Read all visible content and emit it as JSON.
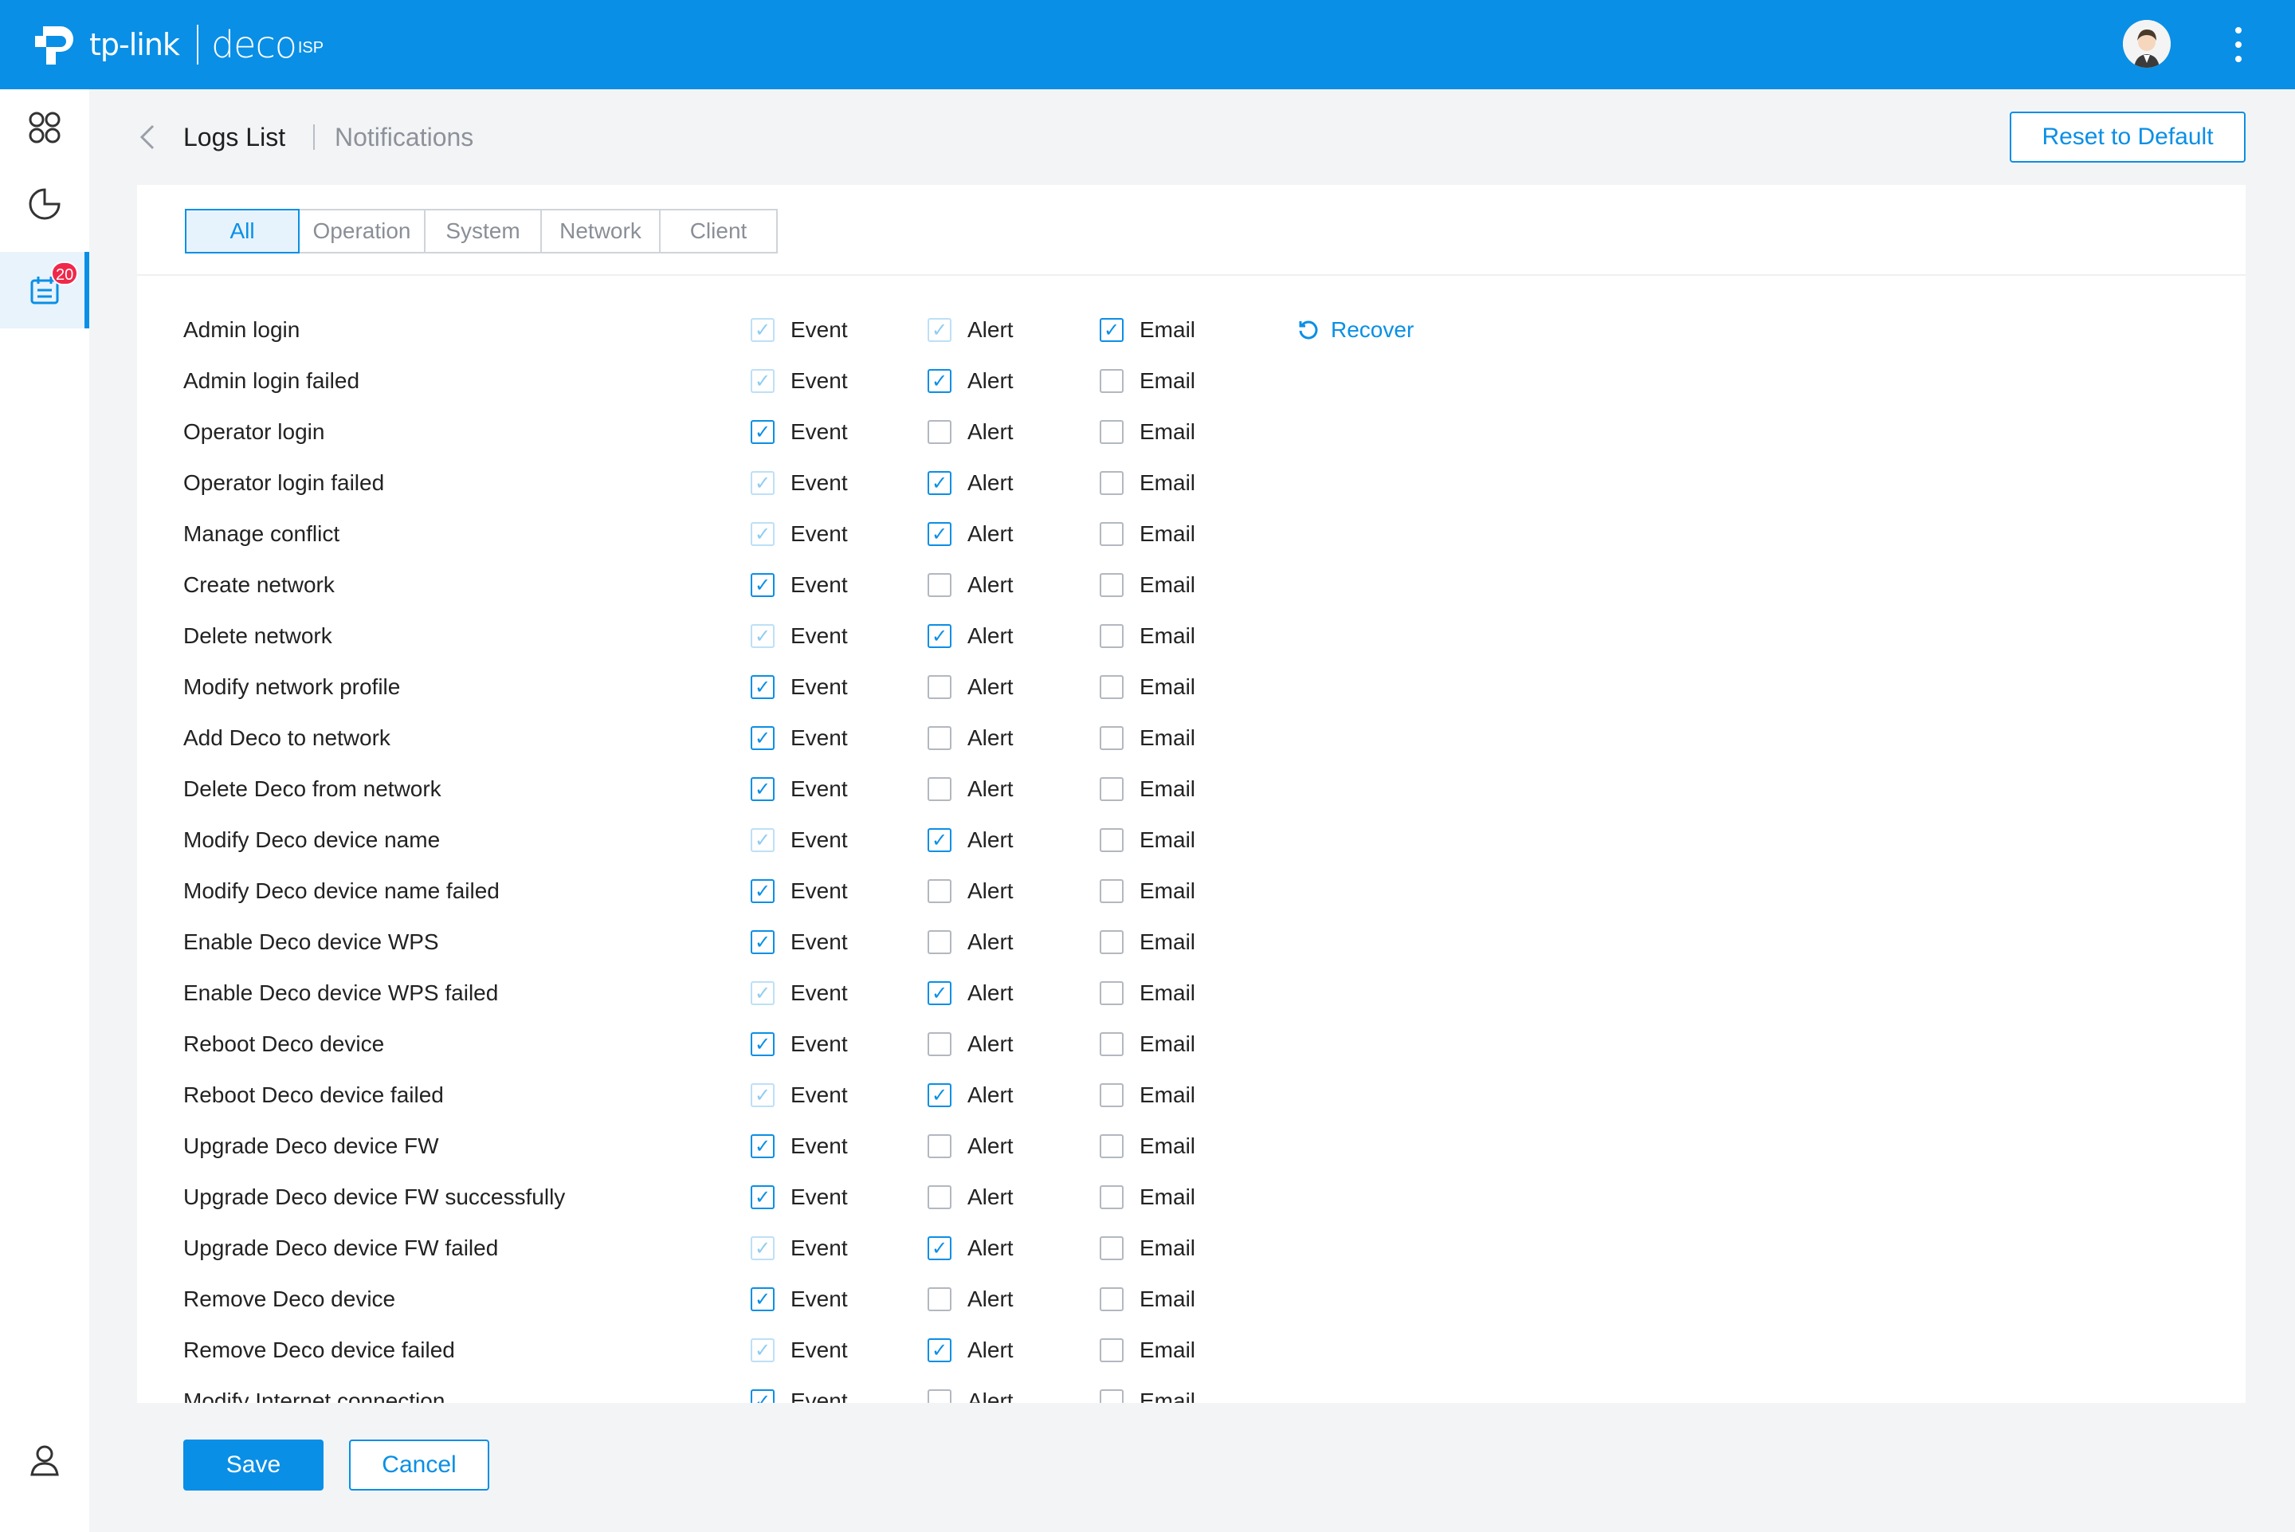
{
  "header": {
    "brand": "tp-link",
    "product": "deco",
    "product_sup": "ISP"
  },
  "sidebar": {
    "badge_count": "20"
  },
  "page": {
    "title": "Logs List",
    "subtitle": "Notifications",
    "reset_label": "Reset to Default"
  },
  "tabs": [
    {
      "label": "All",
      "active": true
    },
    {
      "label": "Operation",
      "active": false
    },
    {
      "label": "System",
      "active": false
    },
    {
      "label": "Network",
      "active": false
    },
    {
      "label": "Client",
      "active": false
    }
  ],
  "columns": {
    "event": "Event",
    "alert": "Alert",
    "email": "Email"
  },
  "recover_label": "Recover",
  "rows": [
    {
      "name": "Admin login",
      "event": "checked-disabled",
      "alert": "checked-disabled",
      "email": "checked",
      "recover": true
    },
    {
      "name": "Admin login failed",
      "event": "checked-disabled",
      "alert": "checked",
      "email": "unchecked"
    },
    {
      "name": "Operator login",
      "event": "checked",
      "alert": "unchecked",
      "email": "unchecked"
    },
    {
      "name": "Operator login failed",
      "event": "checked-disabled",
      "alert": "checked",
      "email": "unchecked"
    },
    {
      "name": "Manage conflict",
      "event": "checked-disabled",
      "alert": "checked",
      "email": "unchecked"
    },
    {
      "name": "Create network",
      "event": "checked",
      "alert": "unchecked",
      "email": "unchecked"
    },
    {
      "name": "Delete network",
      "event": "checked-disabled",
      "alert": "checked",
      "email": "unchecked"
    },
    {
      "name": "Modify network profile",
      "event": "checked",
      "alert": "unchecked",
      "email": "unchecked"
    },
    {
      "name": "Add Deco to network",
      "event": "checked",
      "alert": "unchecked",
      "email": "unchecked"
    },
    {
      "name": "Delete Deco from network",
      "event": "checked",
      "alert": "unchecked",
      "email": "unchecked"
    },
    {
      "name": "Modify Deco device name",
      "event": "checked-disabled",
      "alert": "checked",
      "email": "unchecked"
    },
    {
      "name": "Modify Deco device name failed",
      "event": "checked",
      "alert": "unchecked",
      "email": "unchecked"
    },
    {
      "name": "Enable Deco device WPS",
      "event": "checked",
      "alert": "unchecked",
      "email": "unchecked"
    },
    {
      "name": "Enable Deco device WPS failed",
      "event": "checked-disabled",
      "alert": "checked",
      "email": "unchecked"
    },
    {
      "name": "Reboot Deco device",
      "event": "checked",
      "alert": "unchecked",
      "email": "unchecked"
    },
    {
      "name": "Reboot Deco device failed",
      "event": "checked-disabled",
      "alert": "checked",
      "email": "unchecked"
    },
    {
      "name": "Upgrade Deco device FW",
      "event": "checked",
      "alert": "unchecked",
      "email": "unchecked"
    },
    {
      "name": "Upgrade Deco device FW successfully",
      "event": "checked",
      "alert": "unchecked",
      "email": "unchecked"
    },
    {
      "name": "Upgrade Deco device FW failed",
      "event": "checked-disabled",
      "alert": "checked",
      "email": "unchecked"
    },
    {
      "name": "Remove Deco device",
      "event": "checked",
      "alert": "unchecked",
      "email": "unchecked"
    },
    {
      "name": "Remove Deco device failed",
      "event": "checked-disabled",
      "alert": "checked",
      "email": "unchecked"
    },
    {
      "name": "Modify Internet connection",
      "event": "checked",
      "alert": "unchecked",
      "email": "unchecked"
    }
  ],
  "footer": {
    "save_label": "Save",
    "cancel_label": "Cancel"
  },
  "colors": {
    "accent": "#0a8fe6",
    "badge": "#f0284a"
  }
}
